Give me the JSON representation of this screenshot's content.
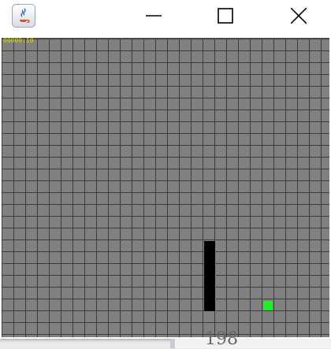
{
  "window": {
    "icon": "java-coffee-cup-icon",
    "controls": [
      "minimize-icon",
      "maximize-icon",
      "close-icon"
    ]
  },
  "game": {
    "score_text": "00000:10",
    "grid": {
      "columns": 28,
      "rows": 25
    },
    "snake": {
      "head_cell": {
        "col": 17,
        "row": 17
      },
      "tail_cell": {
        "col": 17,
        "row": 22
      },
      "length": 6,
      "direction": "vertical"
    },
    "food": {
      "col": 22,
      "row": 22
    },
    "colors": {
      "board": "#808080",
      "grid_lines": "#3c3c3c",
      "snake": "#000000",
      "food": "#22ee22",
      "score": "#e0d400"
    }
  },
  "background_window": {
    "partial_text": "198"
  }
}
